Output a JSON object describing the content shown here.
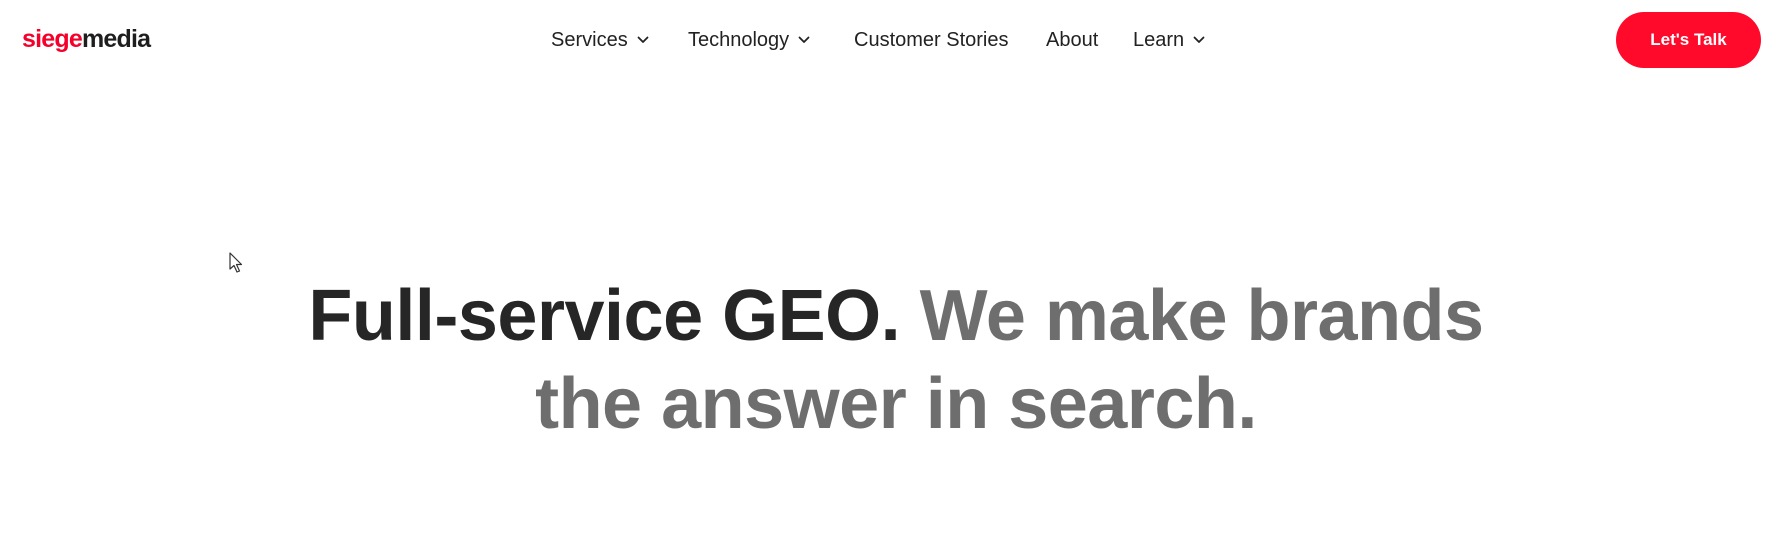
{
  "header": {
    "logo": {
      "part1": "siege",
      "part2": "media"
    },
    "nav": [
      {
        "label": "Services",
        "has_dropdown": true,
        "icon": "chevron-down-icon"
      },
      {
        "label": "Technology",
        "has_dropdown": true,
        "icon": "chevron-down-icon"
      },
      {
        "label": "Customer Stories",
        "has_dropdown": false
      },
      {
        "label": "About",
        "has_dropdown": false
      },
      {
        "label": "Learn",
        "has_dropdown": true,
        "icon": "chevron-down-icon"
      }
    ],
    "cta_label": "Let's Talk"
  },
  "hero": {
    "headline_dark": "Full-service GEO.",
    "headline_gray_line1": "We make brands",
    "headline_gray_line2": "the answer in search."
  },
  "colors": {
    "brand_red": "#f4002a",
    "cta_red": "#ff0a2b",
    "text_dark": "#262626",
    "text_gray": "#6e6e6e"
  },
  "cursor": {
    "icon": "mouse-pointer-icon"
  }
}
